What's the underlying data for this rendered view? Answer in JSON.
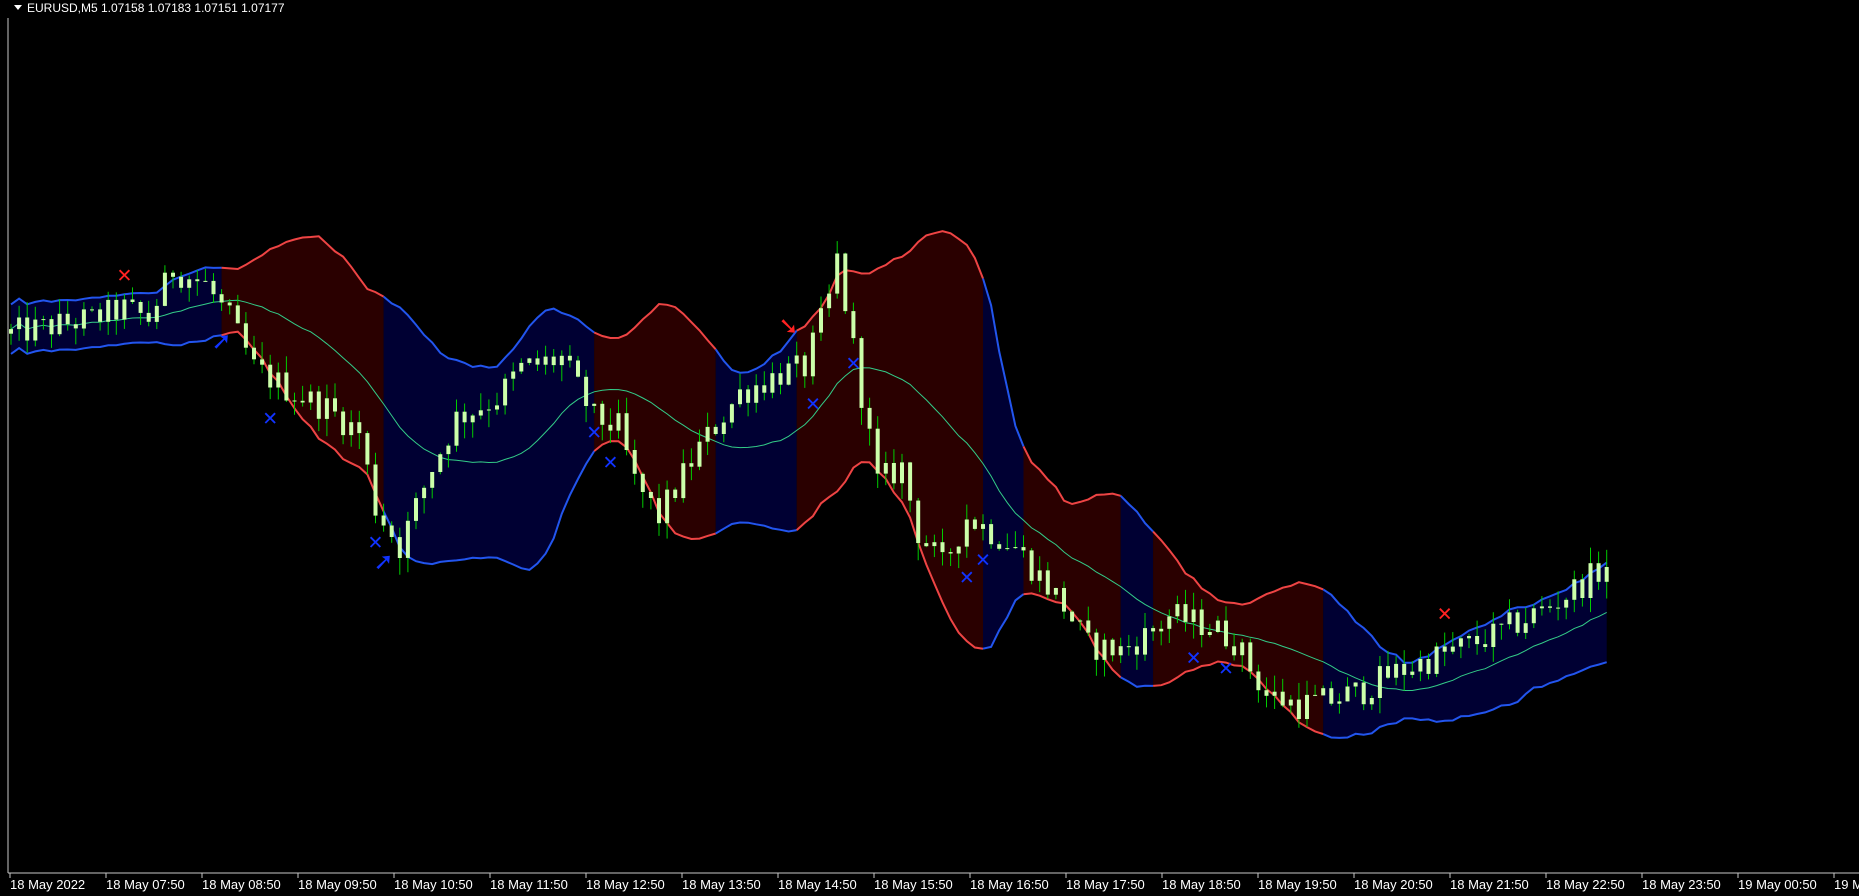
{
  "header": {
    "symbol_timeframe": "EURUSD,M5",
    "ohlc": "1.07158 1.07183 1.07151 1.07177",
    "menu_icon": "triangle-down-icon"
  },
  "colors": {
    "background": "#000000",
    "axis": "#ffffff",
    "bull_candle": "#ccffaa",
    "bear_candle": "#ccffaa",
    "wick": "#00cc00",
    "middle_band": "#33cc88",
    "upper_band_up": "#2255ee",
    "upper_band_down": "#ee4444",
    "fill_up": "#000033",
    "fill_down": "#2a0000",
    "signal_buy": "#1133ff",
    "signal_sell": "#ff2222"
  },
  "chart_data": {
    "type": "candlestick",
    "symbol": "EURUSD",
    "timeframe": "M5",
    "x_labels": [
      "18 May 2022",
      "18 May 07:50",
      "18 May 08:50",
      "18 May 09:50",
      "18 May 10:50",
      "18 May 11:50",
      "18 May 12:50",
      "18 May 13:50",
      "18 May 14:50",
      "18 May 15:50",
      "18 May 16:50",
      "18 May 17:50",
      "18 May 18:50",
      "18 May 19:50",
      "18 May 20:50",
      "18 May 21:50",
      "18 May 22:50",
      "18 May 23:50",
      "19 May 00:50",
      "19 M"
    ],
    "bars_per_label": 12,
    "y_range": [
      0.0,
      100.0
    ],
    "close_path": [
      [
        0,
        75
      ],
      [
        10,
        78
      ],
      [
        14,
        80
      ],
      [
        17,
        78
      ],
      [
        20,
        88
      ],
      [
        24,
        85
      ],
      [
        27,
        78
      ],
      [
        30,
        68
      ],
      [
        35,
        63
      ],
      [
        39,
        60
      ],
      [
        43,
        55
      ],
      [
        45,
        40
      ],
      [
        48,
        32
      ],
      [
        52,
        48
      ],
      [
        55,
        58
      ],
      [
        60,
        62
      ],
      [
        63,
        68
      ],
      [
        68,
        70
      ],
      [
        72,
        58
      ],
      [
        75,
        56
      ],
      [
        77,
        45
      ],
      [
        80,
        38
      ],
      [
        85,
        52
      ],
      [
        90,
        63
      ],
      [
        95,
        67
      ],
      [
        98,
        68
      ],
      [
        101,
        82
      ],
      [
        102,
        90
      ],
      [
        104,
        72
      ],
      [
        107,
        45
      ],
      [
        110,
        48
      ],
      [
        112,
        35
      ],
      [
        115,
        28
      ],
      [
        118,
        38
      ],
      [
        121,
        35
      ],
      [
        124,
        32
      ],
      [
        126,
        28
      ],
      [
        130,
        20
      ],
      [
        133,
        12
      ],
      [
        137,
        11
      ],
      [
        141,
        15
      ],
      [
        143,
        18
      ],
      [
        148,
        16
      ],
      [
        151,
        13
      ],
      [
        155,
        2
      ],
      [
        159,
        0
      ],
      [
        163,
        1
      ],
      [
        167,
        3
      ],
      [
        170,
        6
      ],
      [
        178,
        11
      ],
      [
        183,
        14
      ],
      [
        190,
        20
      ],
      [
        197,
        28
      ]
    ],
    "band_segments": [
      {
        "from": 0,
        "to": 26,
        "trend": "up"
      },
      {
        "from": 26,
        "to": 46,
        "trend": "down"
      },
      {
        "from": 46,
        "to": 72,
        "trend": "up"
      },
      {
        "from": 72,
        "to": 87,
        "trend": "down"
      },
      {
        "from": 87,
        "to": 97,
        "trend": "up"
      },
      {
        "from": 97,
        "to": 120,
        "trend": "down"
      },
      {
        "from": 120,
        "to": 125,
        "trend": "up"
      },
      {
        "from": 125,
        "to": 137,
        "trend": "down"
      },
      {
        "from": 137,
        "to": 141,
        "trend": "up"
      },
      {
        "from": 141,
        "to": 162,
        "trend": "down"
      },
      {
        "from": 162,
        "to": 198,
        "trend": "up"
      }
    ],
    "signals": [
      {
        "bar": 14,
        "kind": "cross",
        "color": "sell",
        "position": "above"
      },
      {
        "bar": 26,
        "kind": "arrow-up",
        "color": "buy",
        "position": "below"
      },
      {
        "bar": 32,
        "kind": "cross",
        "color": "buy",
        "position": "below"
      },
      {
        "bar": 45,
        "kind": "cross",
        "color": "buy",
        "position": "below"
      },
      {
        "bar": 46,
        "kind": "arrow-up",
        "color": "buy",
        "position": "below"
      },
      {
        "bar": 72,
        "kind": "cross",
        "color": "buy",
        "position": "below"
      },
      {
        "bar": 74,
        "kind": "cross",
        "color": "buy",
        "position": "below"
      },
      {
        "bar": 96,
        "kind": "arrow-down",
        "color": "sell",
        "position": "above"
      },
      {
        "bar": 99,
        "kind": "cross",
        "color": "buy",
        "position": "below"
      },
      {
        "bar": 104,
        "kind": "cross",
        "color": "buy",
        "position": "below"
      },
      {
        "bar": 118,
        "kind": "cross",
        "color": "buy",
        "position": "below"
      },
      {
        "bar": 120,
        "kind": "cross",
        "color": "buy",
        "position": "below"
      },
      {
        "bar": 146,
        "kind": "cross",
        "color": "buy",
        "position": "below"
      },
      {
        "bar": 150,
        "kind": "cross",
        "color": "buy",
        "position": "below"
      },
      {
        "bar": 177,
        "kind": "cross",
        "color": "sell",
        "position": "above"
      }
    ]
  }
}
